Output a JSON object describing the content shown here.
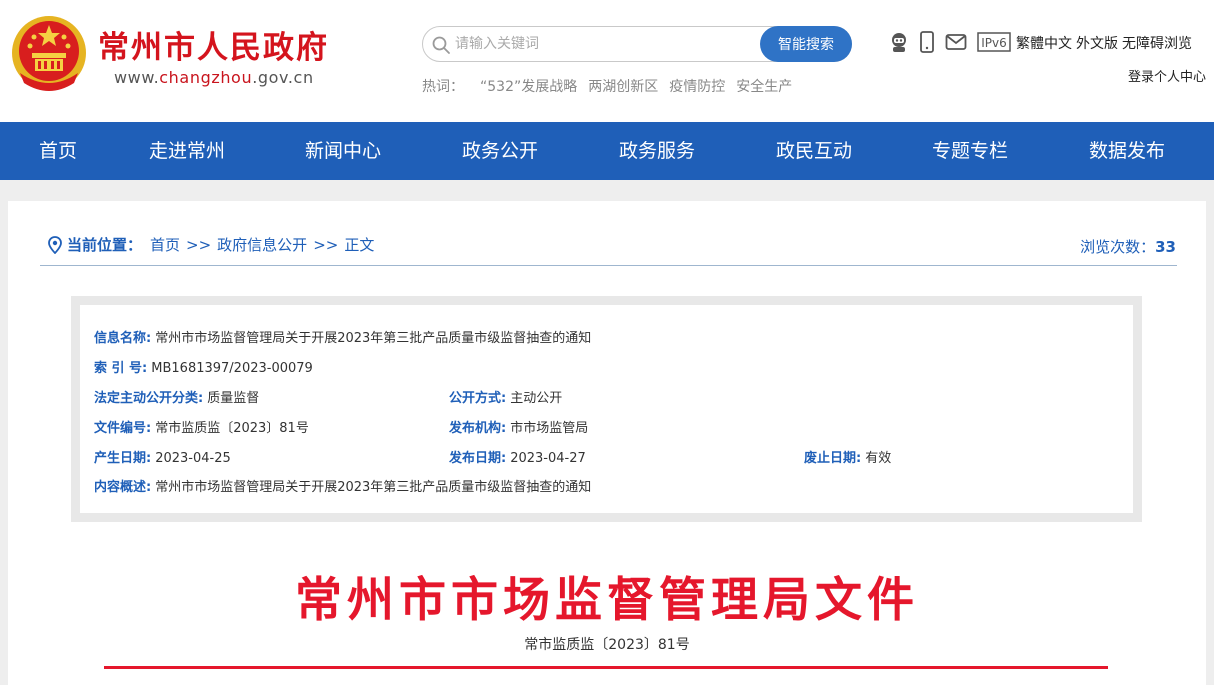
{
  "header": {
    "title": "常州市人民政府",
    "domain_prefix": "www.",
    "domain_brand": "changzhou",
    "domain_suffix": ".gov.cn",
    "emblem_icon": "national-emblem-icon"
  },
  "search": {
    "placeholder": "请输入关键词",
    "button_label": "智能搜索"
  },
  "hotwords": {
    "label": "热词：",
    "items": [
      "“532”发展战略",
      "两湖创新区",
      "疫情防控",
      "安全生产"
    ]
  },
  "utility": {
    "icons": [
      "robot-icon",
      "mobile-icon",
      "mail-icon",
      "ipv6-icon"
    ],
    "ipv6_label": "IPv6",
    "links": [
      "繁體中文",
      "外文版",
      "无障碍浏览"
    ],
    "login": "登录个人中心"
  },
  "nav": {
    "items": [
      "首页",
      "走进常州",
      "新闻中心",
      "政务公开",
      "政务服务",
      "政民互动",
      "专题专栏",
      "数据发布"
    ]
  },
  "breadcrumb": {
    "label": "当前位置：",
    "items": [
      "首页",
      "政府信息公开",
      "正文"
    ],
    "separator": ">>"
  },
  "views": {
    "label": "浏览次数：",
    "count": "33"
  },
  "info": {
    "name_key": "信息名称:",
    "name_val": "常州市市场监督管理局关于开展2023年第三批产品质量市级监督抽查的通知",
    "index_key": "索 引 号:",
    "index_val": "MB1681397/2023-00079",
    "category_key": "法定主动公开分类:",
    "category_val": "质量监督",
    "method_key": "公开方式:",
    "method_val": "主动公开",
    "docno_key": "文件编号:",
    "docno_val": "常市监质监〔2023〕81号",
    "issuer_key": "发布机构:",
    "issuer_val": "市市场监管局",
    "created_key": "产生日期:",
    "created_val": "2023-04-25",
    "published_key": "发布日期:",
    "published_val": "2023-04-27",
    "abolish_key": "废止日期:",
    "abolish_val": "有效",
    "summary_key": "内容概述:",
    "summary_val": "常州市市场监督管理局关于开展2023年第三批产品质量市级监督抽查的通知"
  },
  "document": {
    "title": "常州市市场监督管理局文件",
    "number": "常市监质监〔2023〕81号"
  },
  "colors": {
    "brand_red": "#d4141d",
    "nav_blue": "#1f5fb8",
    "doc_red": "#e5172c"
  }
}
